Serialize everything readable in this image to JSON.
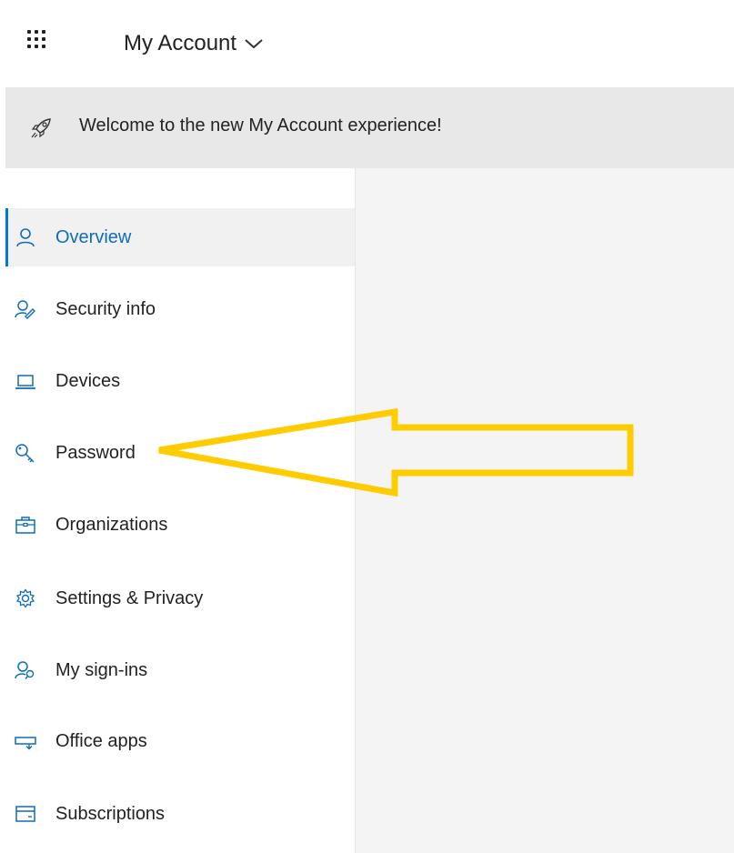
{
  "header": {
    "app_title": "My Account",
    "waffle_icon": "app-launcher-icon",
    "title_chevron_icon": "chevron-down-icon"
  },
  "banner": {
    "icon": "rocket-icon",
    "text": "Welcome to the new My Account experience!"
  },
  "sidebar": {
    "items": [
      {
        "label": "Overview",
        "icon": "person-icon",
        "active": true
      },
      {
        "label": "Security info",
        "icon": "person-key-icon",
        "active": false
      },
      {
        "label": "Devices",
        "icon": "laptop-icon",
        "active": false
      },
      {
        "label": "Password",
        "icon": "key-icon",
        "active": false
      },
      {
        "label": "Organizations",
        "icon": "briefcase-icon",
        "active": false
      },
      {
        "label": "Settings & Privacy",
        "icon": "gear-icon",
        "active": false
      },
      {
        "label": "My sign-ins",
        "icon": "person-search-icon",
        "active": false
      },
      {
        "label": "Office apps",
        "icon": "office-apps-icon",
        "active": false
      },
      {
        "label": "Subscriptions",
        "icon": "card-icon",
        "active": false
      }
    ]
  },
  "annotation": {
    "arrow_color": "#ffcc00",
    "points_to": "Password"
  },
  "colors": {
    "accent": "#0078d4",
    "banner_bg": "#e8e8e8",
    "content_bg": "#f4f4f4"
  }
}
